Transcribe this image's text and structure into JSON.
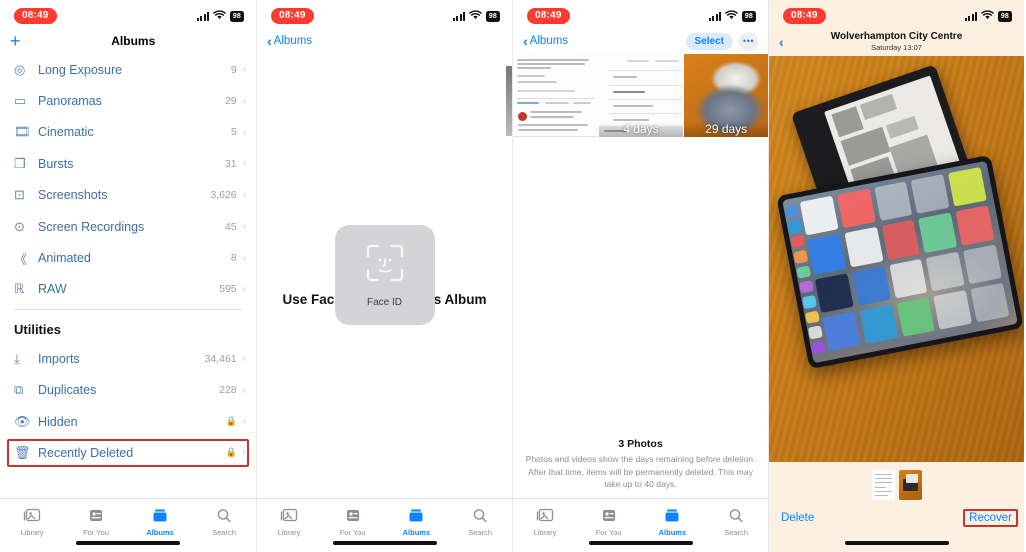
{
  "status_bar": {
    "time": "08:49",
    "battery": "98",
    "signal_icon": "cellular-bars-icon",
    "wifi_icon": "wifi-icon"
  },
  "panel1": {
    "nav": {
      "add_label": "+",
      "title": "Albums"
    },
    "albums": [
      {
        "icon": "long-exposure-icon",
        "label": "Long Exposure",
        "count": "9"
      },
      {
        "icon": "panorama-icon",
        "label": "Panoramas",
        "count": "29"
      },
      {
        "icon": "cinematic-icon",
        "label": "Cinematic",
        "count": "5"
      },
      {
        "icon": "bursts-icon",
        "label": "Bursts",
        "count": "31"
      },
      {
        "icon": "screenshots-icon",
        "label": "Screenshots",
        "count": "3,626"
      },
      {
        "icon": "screen-recordings-icon",
        "label": "Screen Recordings",
        "count": "45"
      },
      {
        "icon": "animated-icon",
        "label": "Animated",
        "count": "8"
      },
      {
        "icon": "raw-icon",
        "label": "RAW",
        "count": "595"
      }
    ],
    "utilities_header": "Utilities",
    "utilities": [
      {
        "icon": "imports-icon",
        "label": "Imports",
        "count": "34,461",
        "locked": false
      },
      {
        "icon": "duplicates-icon",
        "label": "Duplicates",
        "count": "228",
        "locked": false
      },
      {
        "icon": "hidden-icon",
        "label": "Hidden",
        "count": "",
        "locked": true
      },
      {
        "icon": "trash-icon",
        "label": "Recently Deleted",
        "count": "",
        "locked": true,
        "highlighted": true
      }
    ],
    "tabs": [
      {
        "icon": "library-icon",
        "label": "Library",
        "active": false
      },
      {
        "icon": "for-you-icon",
        "label": "For You",
        "active": false
      },
      {
        "icon": "albums-icon",
        "label": "Albums",
        "active": true
      },
      {
        "icon": "search-icon",
        "label": "Search",
        "active": false
      }
    ]
  },
  "panel2": {
    "nav": {
      "back_label": "Albums"
    },
    "unlock_prompt": "Use Face ID to View This Album",
    "faceid_card_label": "Face ID",
    "faceid_icon": "face-id-icon",
    "tabs": [
      {
        "icon": "library-icon",
        "label": "Library",
        "active": false
      },
      {
        "icon": "for-you-icon",
        "label": "For You",
        "active": false
      },
      {
        "icon": "albums-icon",
        "label": "Albums",
        "active": true
      },
      {
        "icon": "search-icon",
        "label": "Search",
        "active": false
      }
    ]
  },
  "panel3": {
    "nav": {
      "back_label": "Albums",
      "select_label": "Select",
      "more_icon": "more-ellipsis-icon"
    },
    "items": [
      {
        "type": "document",
        "days": ""
      },
      {
        "type": "document",
        "days": "4 days"
      },
      {
        "type": "photo",
        "days": "29 days"
      }
    ],
    "footer_title": "3 Photos",
    "footer_body": "Photos and videos show the days remaining before deletion. After that time, items will be permanently deleted. This may take up to 40 days.",
    "tabs": [
      {
        "icon": "library-icon",
        "label": "Library",
        "active": false
      },
      {
        "icon": "for-you-icon",
        "label": "For You",
        "active": false
      },
      {
        "icon": "albums-icon",
        "label": "Albums",
        "active": true
      },
      {
        "icon": "search-icon",
        "label": "Search",
        "active": false
      }
    ]
  },
  "panel4": {
    "nav": {
      "back_icon": "chevron-left-icon",
      "title": "Wolverhampton City Centre",
      "subtitle": "Saturday  13:07"
    },
    "actions": {
      "delete_label": "Delete",
      "recover_label": "Recover"
    }
  },
  "colors": {
    "accent_blue": "#0a84ff",
    "link_blue": "#3c6fa5",
    "highlight_red": "#c0392b",
    "time_pill_red": "#ff3b30"
  }
}
